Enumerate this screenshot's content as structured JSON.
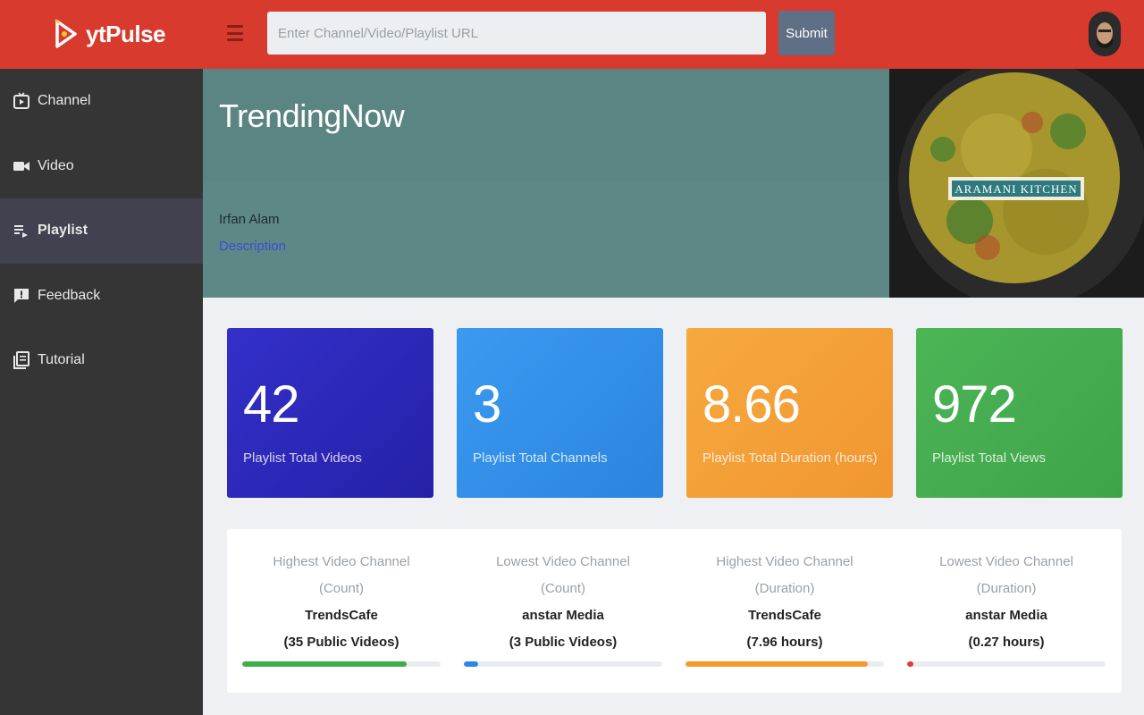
{
  "app": {
    "name": "ytPulse"
  },
  "search": {
    "placeholder": "Enter Channel/Video/Playlist URL",
    "submit_label": "Submit"
  },
  "sidebar": {
    "items": [
      {
        "label": "Channel",
        "icon": "tv-icon"
      },
      {
        "label": "Video",
        "icon": "camera-icon"
      },
      {
        "label": "Playlist",
        "icon": "playlist-icon",
        "active": true
      },
      {
        "label": "Feedback",
        "icon": "feedback-icon"
      },
      {
        "label": "Tutorial",
        "icon": "book-icon"
      }
    ]
  },
  "playlist": {
    "title": "TrendingNow",
    "owner": "Irfan Alam",
    "description_link": "Description",
    "thumbnail_text": "ARAMANI KITCHEN"
  },
  "cards": [
    {
      "value": "42",
      "label": "Playlist Total Videos",
      "color": "#2e2bc0"
    },
    {
      "value": "3",
      "label": "Playlist Total Channels",
      "color": "#3592e8"
    },
    {
      "value": "8.66",
      "label": "Playlist Total Duration (hours)",
      "color": "#f4a038"
    },
    {
      "value": "972",
      "label": "Playlist Total Views",
      "color": "#46ae50"
    }
  ],
  "stats": [
    {
      "caption1": "Highest Video Channel",
      "caption2": "(Count)",
      "name": "TrendsCafe",
      "detail": "(35 Public Videos)",
      "progress": 0.83,
      "color": "#3fae49"
    },
    {
      "caption1": "Lowest Video Channel",
      "caption2": "(Count)",
      "name": "anstar Media",
      "detail": "(3 Public Videos)",
      "progress": 0.07,
      "color": "#2f86e8"
    },
    {
      "caption1": "Highest Video Channel",
      "caption2": "(Duration)",
      "name": "TrendsCafe",
      "detail": "(7.96 hours)",
      "progress": 0.92,
      "color": "#f39a2f"
    },
    {
      "caption1": "Lowest Video Channel",
      "caption2": "(Duration)",
      "name": "anstar Media",
      "detail": "(0.27 hours)",
      "progress": 0.03,
      "color": "#e53935"
    }
  ]
}
